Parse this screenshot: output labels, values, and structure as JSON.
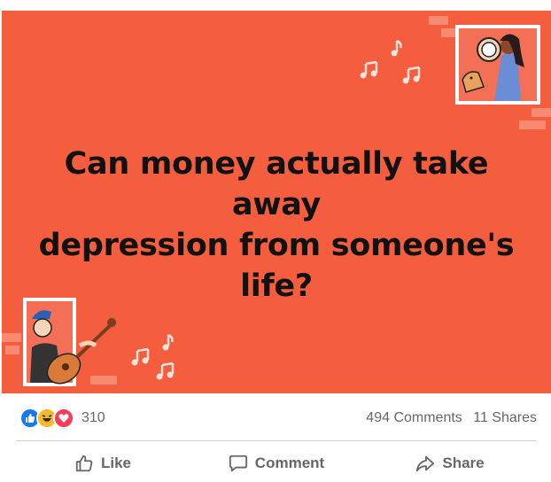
{
  "post": {
    "question_line1": "Can money actually take away",
    "question_line2": "depression from someone's",
    "question_line3": "life?",
    "background_color": "#F45D3E"
  },
  "illustrations": {
    "top_right": "woman-with-tambourine-and-dog",
    "bottom_left": "man-playing-guitar",
    "notes": "music-note-icon"
  },
  "stats": {
    "reactions": [
      "like-icon",
      "haha-icon",
      "love-icon"
    ],
    "reaction_count": "310",
    "comments": "494 Comments",
    "shares": "11 Shares"
  },
  "actions": {
    "like": "Like",
    "comment": "Comment",
    "share": "Share"
  },
  "colors": {
    "like_blue": "#1877F2",
    "haha_yellow": "#F7B928",
    "love_red": "#F33E58",
    "muted_text": "#65676B"
  }
}
